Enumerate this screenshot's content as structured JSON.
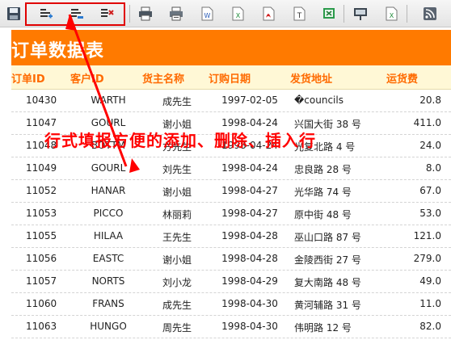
{
  "toolbar": {
    "icons": [
      "save-icon",
      "add-row-icon",
      "insert-row-icon",
      "delete-row-icon",
      "print-icon",
      "print-setup-icon",
      "export-word-icon",
      "export-excel-icon",
      "export-pdf-icon",
      "export-text-icon",
      "import-excel-icon",
      "presentation-icon",
      "excel-plus-icon",
      "rss-icon"
    ],
    "glyph_word": "W",
    "glyph_excel": "X",
    "glyph_text": "T",
    "glyph_excel2": "X"
  },
  "report": {
    "title": "订单数据表",
    "columns": [
      "订单ID",
      "客户ID",
      "货主名称",
      "订购日期",
      "发货地址",
      "运货费"
    ],
    "rows": [
      {
        "id": "10430",
        "cust": "WARTH",
        "name": "成先生",
        "date": "1997-02-05",
        "addr": "�councils",
        "fee": "20.8"
      },
      {
        "id": "11047",
        "cust": "GOURL",
        "name": "谢小姐",
        "date": "1998-04-24",
        "addr": "兴国大街 38 号",
        "fee": "411.0"
      },
      {
        "id": "11048",
        "cust": "BOTTM",
        "name": "方先生",
        "date": "1998-04-24",
        "addr": "光复北路 4 号",
        "fee": "24.0"
      },
      {
        "id": "11049",
        "cust": "GOURL",
        "name": "刘先生",
        "date": "1998-04-24",
        "addr": "忠良路 28 号",
        "fee": "8.0"
      },
      {
        "id": "11052",
        "cust": "HANAR",
        "name": "谢小姐",
        "date": "1998-04-27",
        "addr": "光华路 74 号",
        "fee": "67.0"
      },
      {
        "id": "11053",
        "cust": "PICCO",
        "name": "林丽莉",
        "date": "1998-04-27",
        "addr": "原中街 48 号",
        "fee": "53.0"
      },
      {
        "id": "11055",
        "cust": "HILAA",
        "name": "王先生",
        "date": "1998-04-28",
        "addr": "巫山口路 87 号",
        "fee": "121.0"
      },
      {
        "id": "11056",
        "cust": "EASTC",
        "name": "谢小姐",
        "date": "1998-04-28",
        "addr": "金陵西街 27 号",
        "fee": "279.0"
      },
      {
        "id": "11057",
        "cust": "NORTS",
        "name": "刘小龙",
        "date": "1998-04-29",
        "addr": "复大南路 48 号",
        "fee": "49.0"
      },
      {
        "id": "11060",
        "cust": "FRANS",
        "name": "成先生",
        "date": "1998-04-30",
        "addr": "黄河辅路 31 号",
        "fee": "11.0"
      },
      {
        "id": "11063",
        "cust": "HUNGO",
        "name": "周先生",
        "date": "1998-04-30",
        "addr": "伟明路 12 号",
        "fee": "82.0"
      }
    ]
  },
  "annotation": {
    "text": "行式填报方便的添加、删除、插入行",
    "color": "#ff0000"
  },
  "colors": {
    "title_bg": "#ff7a00",
    "header_text": "#ff6a00",
    "header_bg": "#fff8d6",
    "highlight_box": "#e00000"
  }
}
